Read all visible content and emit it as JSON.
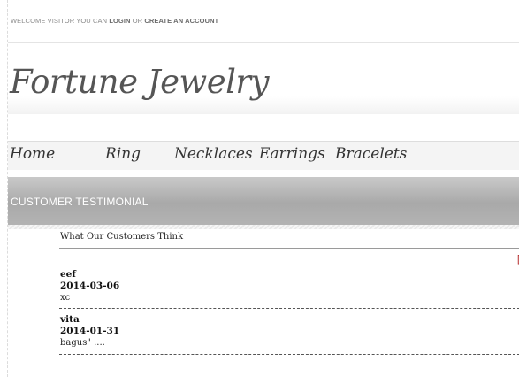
{
  "topbar": {
    "welcome_prefix": "WELCOME VISITOR YOU CAN",
    "login_label": "LOGIN",
    "or_text": "OR",
    "create_account_label": "CREATE AN ACCOUNT"
  },
  "brand": {
    "logo_text": "Fortune Jewelry"
  },
  "nav": {
    "items": [
      {
        "label": "Home"
      },
      {
        "label": "Ring"
      },
      {
        "label": "Necklaces"
      },
      {
        "label": "Earrings"
      },
      {
        "label": "Bracelets"
      }
    ]
  },
  "section": {
    "title": "CUSTOMER TESTIMONIAL"
  },
  "testimonials": {
    "heading": "What Our Customers Think",
    "corner_text": "[",
    "entries": [
      {
        "name": "eef",
        "date": "2014-03-06",
        "message": "xc"
      },
      {
        "name": "vita",
        "date": "2014-01-31",
        "message": "bagus\" ...."
      }
    ]
  },
  "colors": {
    "accent_red": "#b22222",
    "section_bar": "#b0b0b0",
    "text_dark": "#222222"
  }
}
